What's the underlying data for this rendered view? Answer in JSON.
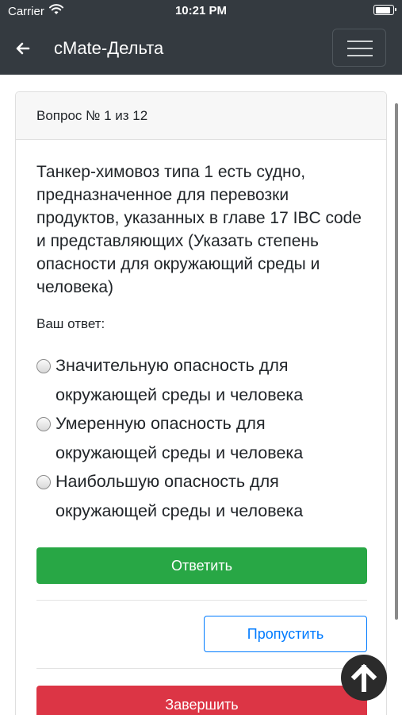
{
  "status_bar": {
    "carrier": "Carrier",
    "time": "10:21 PM",
    "battery_level": 0.9
  },
  "navbar": {
    "title": "cMate-Дельта"
  },
  "card": {
    "header": "Вопрос № 1 из 12",
    "question": "Танкер-химовоз типа 1 есть судно, предназначенное для перевозки продуктов, указанных в главе 17 IBC code и представляющих (Указать степень опасности для окружающий среды и человека)",
    "answer_label": "Ваш ответ:",
    "options": [
      {
        "label": "Значительную опасность для окружающей среды и человека"
      },
      {
        "label": "Умеренную опасность для окружающей среды и человека"
      },
      {
        "label": "Наибольшую опасность для окружающей среды и человека"
      }
    ],
    "answer_button": "Ответить",
    "skip_button": "Пропустить",
    "finish_button": "Завершить"
  },
  "colors": {
    "nav": "#343a40",
    "success": "#28a745",
    "primary": "#007bff",
    "danger": "#dc3545"
  },
  "icons": [
    "wifi-icon",
    "battery-icon",
    "back-arrow-icon",
    "menu-icon",
    "radio-icon",
    "arrow-up-icon"
  ]
}
